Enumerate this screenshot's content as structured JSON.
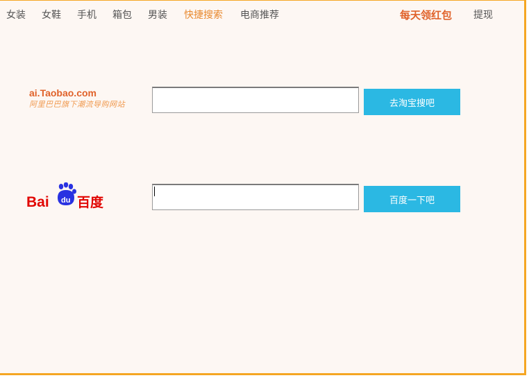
{
  "nav": {
    "items": [
      {
        "label": "女装",
        "active": false
      },
      {
        "label": "女鞋",
        "active": false
      },
      {
        "label": "手机",
        "active": false
      },
      {
        "label": "箱包",
        "active": false
      },
      {
        "label": "男装",
        "active": false
      },
      {
        "label": "快捷搜索",
        "active": true
      },
      {
        "label": "电商推荐",
        "active": false
      }
    ],
    "promo_label": "每天领红包",
    "cash_label": "提现"
  },
  "taobao": {
    "logo_line1": "ai.Taobao.com",
    "logo_line2": "阿里巴巴旗下潮流导购网站",
    "input_value": "",
    "button_label": "去淘宝搜吧"
  },
  "baidu": {
    "logo_bai": "Bai",
    "logo_du": "du",
    "logo_cn": "百度",
    "input_value": "",
    "button_label": "百度一下吧"
  },
  "colors": {
    "accent": "#e0622a",
    "active_nav": "#e8892e",
    "button": "#2bb8e3",
    "frame": "#f5a623",
    "background": "#fdf7f3",
    "baidu_red": "#e10602",
    "baidu_blue": "#2932e1"
  }
}
